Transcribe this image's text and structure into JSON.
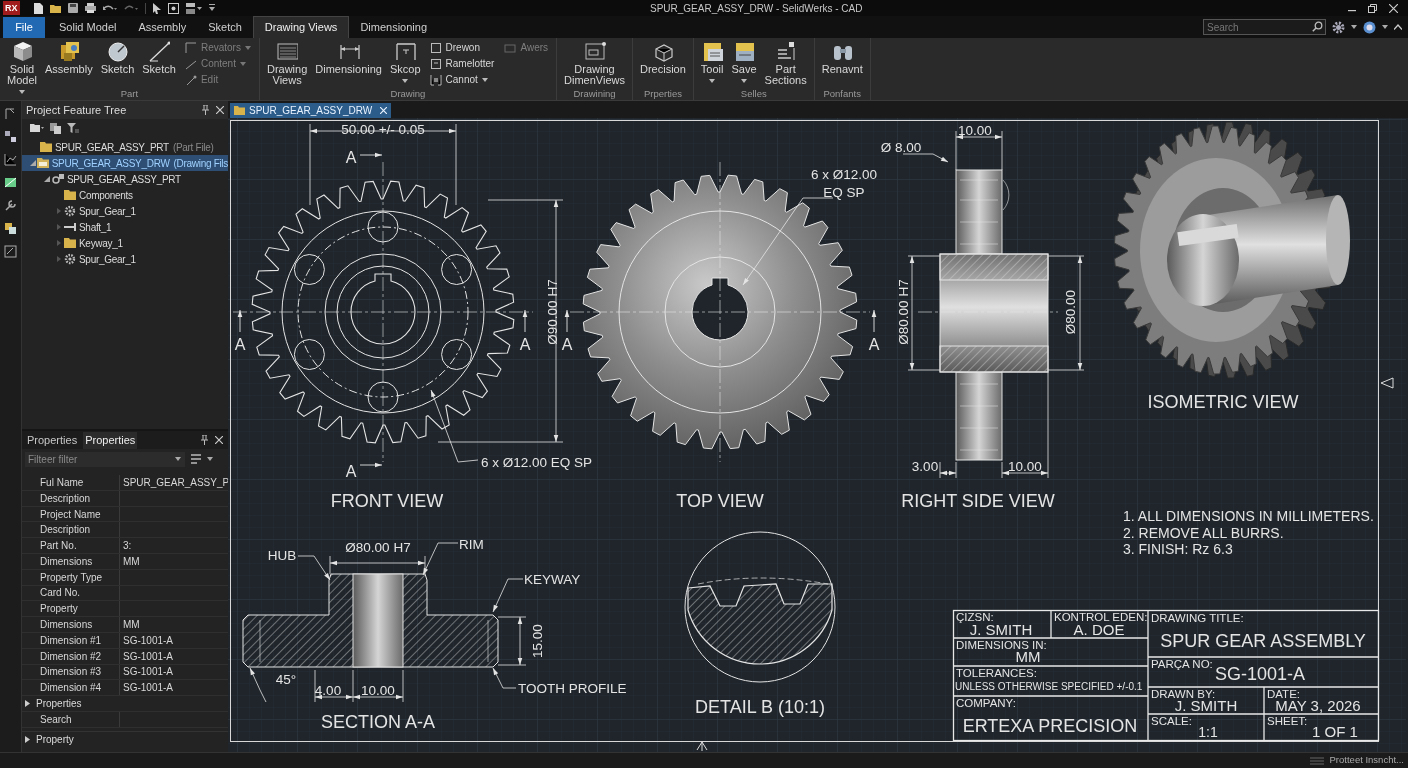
{
  "app_logo": "RX",
  "window": {
    "title": "SPUR_GEAR_ASSY_DRW - SelidWerks - CAD"
  },
  "file_tab": "File",
  "ribbon_tabs": [
    {
      "label": "Solid Model",
      "selected": false
    },
    {
      "label": "Assembly",
      "selected": false
    },
    {
      "label": "Sketch",
      "selected": false
    },
    {
      "label": "Drawing Views",
      "selected": true
    },
    {
      "label": "Dimensioning",
      "selected": false
    }
  ],
  "search": {
    "placeholder": "Search"
  },
  "ribbon_groups": [
    {
      "label": "Part",
      "buttons": [
        {
          "kind": "large",
          "label": "Solid Model",
          "dropdown": true
        },
        {
          "kind": "large",
          "label": "Assembly"
        },
        {
          "kind": "large",
          "label": "Sketch"
        },
        {
          "kind": "large",
          "label": "Sketch"
        },
        {
          "kind": "stack",
          "items": [
            {
              "label": "Revators",
              "dropdown": true,
              "disabled": true
            },
            {
              "label": "Content",
              "dropdown": true,
              "disabled": true
            },
            {
              "label": "Edit",
              "disabled": true
            }
          ]
        }
      ]
    },
    {
      "label": "Drawing",
      "buttons": [
        {
          "kind": "large",
          "label": "Drawing Views"
        },
        {
          "kind": "large",
          "label": "Dimensioning"
        },
        {
          "kind": "large",
          "label": "Skcop",
          "dropdown": true
        },
        {
          "kind": "stack",
          "items": [
            {
              "label": "Drewon",
              "disabled": false
            },
            {
              "label": "Ramelotter",
              "disabled": false
            },
            {
              "label": "Cannot",
              "dropdown": true,
              "disabled": false
            }
          ]
        },
        {
          "kind": "stack",
          "items": [
            {
              "label": "Awers",
              "disabled": true
            }
          ]
        }
      ]
    },
    {
      "label": "Drawining",
      "buttons": [
        {
          "kind": "large",
          "label": "Drawing DimenViews"
        }
      ]
    },
    {
      "label": "Prperties",
      "buttons": [
        {
          "kind": "large",
          "label": "Drecision"
        }
      ]
    },
    {
      "label": "Selles",
      "buttons": [
        {
          "kind": "large",
          "label": "Tooil",
          "dropdown": true
        },
        {
          "kind": "large",
          "label": "Save",
          "dropdown": true
        },
        {
          "kind": "large",
          "label": "Part Sections"
        }
      ]
    },
    {
      "label": "Ponfants",
      "buttons": [
        {
          "kind": "large",
          "label": "Renavnt"
        }
      ]
    }
  ],
  "feature_tree": {
    "title": "Project Feature Tree",
    "items": [
      {
        "label": "SPUR_GEAR_ASSY_PRT",
        "note": "(Part File)",
        "kind": "folder",
        "selected": false
      },
      {
        "label": "SPUR_GEAR_ASSY_DRW",
        "note": "(Drawing Fils",
        "kind": "drawing",
        "selected": true,
        "expanded": true,
        "children": [
          {
            "label": "SPUR_GEAR_ASSY_PRT",
            "kind": "assembly",
            "selected": false,
            "expanded": true,
            "children": [
              {
                "label": "Components",
                "kind": "folder",
                "selected": false
              },
              {
                "label": "Spur_Gear_1",
                "kind": "gear",
                "selected": false,
                "expanded": false
              },
              {
                "label": "Shaft_1",
                "kind": "shaft",
                "selected": false,
                "expanded": false
              },
              {
                "label": "Keyway_1",
                "kind": "folder",
                "selected": false,
                "expanded": false
              },
              {
                "label": "Spur_Gear_1",
                "kind": "gear",
                "selected": false,
                "expanded": false
              }
            ]
          }
        ]
      }
    ]
  },
  "properties": {
    "tabs": [
      {
        "label": "Properties",
        "selected": false
      },
      {
        "label": "Properties",
        "selected": true
      }
    ],
    "filter_placeholder": "Filteer filter",
    "rows": [
      {
        "kind": "row",
        "name": "Ful Name",
        "value": "SPUR_GEAR_ASSY_P"
      },
      {
        "kind": "row",
        "name": "Description"
      },
      {
        "kind": "row",
        "name": "Project Name"
      },
      {
        "kind": "row",
        "name": "Description"
      },
      {
        "kind": "row",
        "name": "Part No.",
        "value": "3:"
      },
      {
        "kind": "row",
        "name": "Dimensions",
        "value": "MM"
      },
      {
        "kind": "row",
        "name": "Property Type"
      },
      {
        "kind": "row",
        "name": "Card No."
      },
      {
        "kind": "row",
        "name": "Property"
      },
      {
        "kind": "row",
        "name": "Dimensions",
        "value": "MM"
      },
      {
        "kind": "row",
        "name": "Dimension #1",
        "value": "SG-1001-A"
      },
      {
        "kind": "row",
        "name": "Dimension #2",
        "value": "SG-1001-A"
      },
      {
        "kind": "row",
        "name": "Dimension #3",
        "value": "SG-1001-A"
      },
      {
        "kind": "row",
        "name": "Dimension #4",
        "value": "SG-1001-A"
      },
      {
        "kind": "group",
        "name": "Properties",
        "expanded": false
      },
      {
        "kind": "row",
        "name": "Search"
      }
    ],
    "footer": {
      "name": "Property",
      "expanded": false
    }
  },
  "document_tab": {
    "label": "SPUR_GEAR_ASSY_DRW"
  },
  "drawing": {
    "front_view": {
      "label": "FRONT VIEW",
      "width_dim": "50.00 +/- 0.05",
      "diameter_dim": "Ø90.00 H7",
      "hole_note": "6 x Ø12.00 EQ SP",
      "section_marks": [
        "A",
        "A",
        "A",
        "A"
      ]
    },
    "top_view": {
      "label": "TOP VIEW",
      "hole_note": [
        "6 x Ø12.00",
        "EQ SP"
      ],
      "section_marks": [
        "A",
        "A"
      ]
    },
    "right_side_view": {
      "label": "RIGHT SIDE VIEW",
      "dims": [
        "Ø 8.00",
        "10.00",
        "Ø80.00 H7",
        "Ø80.00",
        "3.00",
        "10.00"
      ]
    },
    "isometric_view": {
      "label": "ISOMETRIC VIEW"
    },
    "section_view": {
      "label": "SECTION A-A",
      "callouts": [
        "HUB",
        "RIM",
        "KEYWAY",
        "TOOTH PROFILE"
      ],
      "dims": [
        "Ø80.00 H7",
        "15.00",
        "45°",
        "4.00",
        "10.00"
      ]
    },
    "detail_view": {
      "label": "DETAIL B (10:1)"
    },
    "notes": [
      "1. ALL DIMENSIONS IN MILLIMETERS.",
      "2. REMOVE ALL BURRS.",
      "3. FINISH: Rz 6.3"
    ],
    "title_block": [
      {
        "label": "ÇIZSN:",
        "value": "J. SMITH"
      },
      {
        "label": "KONTROL EDEN:",
        "value": "A. DOE"
      },
      {
        "label": "DIMENSIONS IN:",
        "value": "MM"
      },
      {
        "label": "TOLERANCES:",
        "value": "UNLESS OTHERWISE SPECIFIED +/-0.1"
      },
      {
        "label": "COMPANY:",
        "value": "ERTEXA PRECISION"
      },
      {
        "label": "DRAWING TITLE:",
        "value": "SPUR GEAR ASSEMBLY"
      },
      {
        "label": "PARÇA NO:",
        "value": "SG-1001-A"
      },
      {
        "label": "DRAWN BY:",
        "value": "J. SMITH"
      },
      {
        "label": "DATE:",
        "value": "MAY 3, 2026"
      },
      {
        "label": "SCALE:",
        "value": "1:1"
      },
      {
        "label": "SHEET:",
        "value": "1 OF 1"
      }
    ]
  },
  "status_bar": {
    "text": "Protteet Insncht..."
  }
}
